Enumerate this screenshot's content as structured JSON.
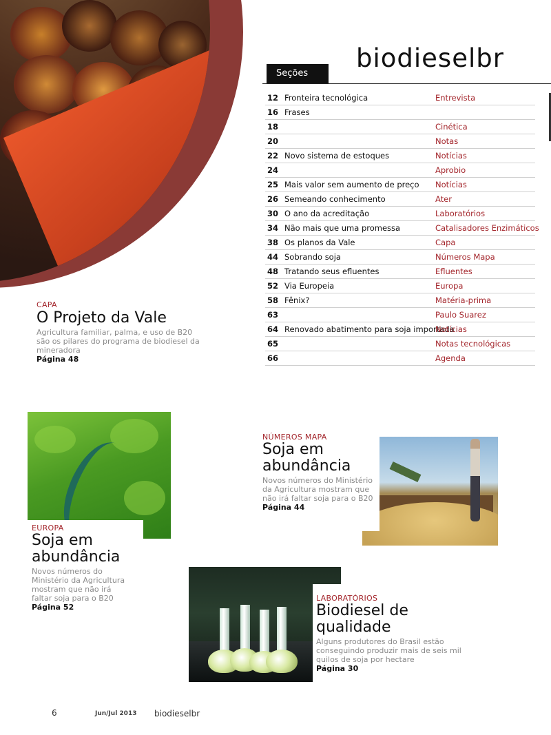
{
  "brand": "biodieselbr",
  "sections_tab": "Seções",
  "index": [
    {
      "page": "12",
      "title": "Fronteira tecnológica",
      "section": "Entrevista"
    },
    {
      "page": "16",
      "title": "Frases",
      "section": ""
    },
    {
      "page": "18",
      "title": "",
      "section": "Cinética"
    },
    {
      "page": "20",
      "title": "",
      "section": "Notas"
    },
    {
      "page": "22",
      "title": "Novo sistema de estoques",
      "section": "Notícias"
    },
    {
      "page": "24",
      "title": "",
      "section": "Aprobio"
    },
    {
      "page": "25",
      "title": "Mais valor sem aumento de preço",
      "section": "Notícias"
    },
    {
      "page": "26",
      "title": "Semeando conhecimento",
      "section": "Ater"
    },
    {
      "page": "30",
      "title": "O ano da acreditação",
      "section": "Laboratórios"
    },
    {
      "page": "34",
      "title": "Não mais que uma promessa",
      "section": "Catalisadores Enzimáticos"
    },
    {
      "page": "38",
      "title": "Os planos da Vale",
      "section": "Capa"
    },
    {
      "page": "44",
      "title": "Sobrando soja",
      "section": "Números Mapa"
    },
    {
      "page": "48",
      "title": "Tratando seus efluentes",
      "section": "Efluentes"
    },
    {
      "page": "52",
      "title": "Via Europeia",
      "section": "Europa"
    },
    {
      "page": "58",
      "title": "Fênix?",
      "section": "Matéria-prima"
    },
    {
      "page": "63",
      "title": "",
      "section": "Paulo Suarez"
    },
    {
      "page": "64",
      "title": "Renovado abatimento para soja importada",
      "section": "Notícias"
    },
    {
      "page": "65",
      "title": "",
      "section": "Notas tecnológicas"
    },
    {
      "page": "66",
      "title": "",
      "section": "Agenda"
    }
  ],
  "stories": {
    "capa": {
      "kicker": "CAPA",
      "headline": "O Projeto da Vale",
      "desc": "Agricultura familiar, palma, e uso de B20 são os pilares do programa de biodiesel da mineradora",
      "page": "Página 48"
    },
    "europa": {
      "kicker": "EUROPA",
      "headline": "Soja em abundância",
      "desc": "Novos números do Ministério da Agricultura mostram que não irá faltar soja para o B20",
      "page": "Página 52"
    },
    "numeros": {
      "kicker": "NÚMEROS MAPA",
      "headline": "Soja em abundância",
      "desc": "Novos números do Ministério da Agricultura mostram que não irá faltar soja para o B20",
      "page": "Página 44"
    },
    "lab": {
      "kicker": "LABORATÓRIOS",
      "headline": "Biodiesel de qualidade",
      "desc": "Alguns produtores do Brasil estão conseguindo produzir mais de seis mil quilos de soja por hectare",
      "page": "Página 30"
    }
  },
  "footer": {
    "page_number": "6",
    "date": "Jun/Jul 2013",
    "brand": "biodieselbr"
  },
  "colors": {
    "accent": "#a3252b",
    "ring": "#8a3a36",
    "muted_text": "#8a8a8a"
  }
}
